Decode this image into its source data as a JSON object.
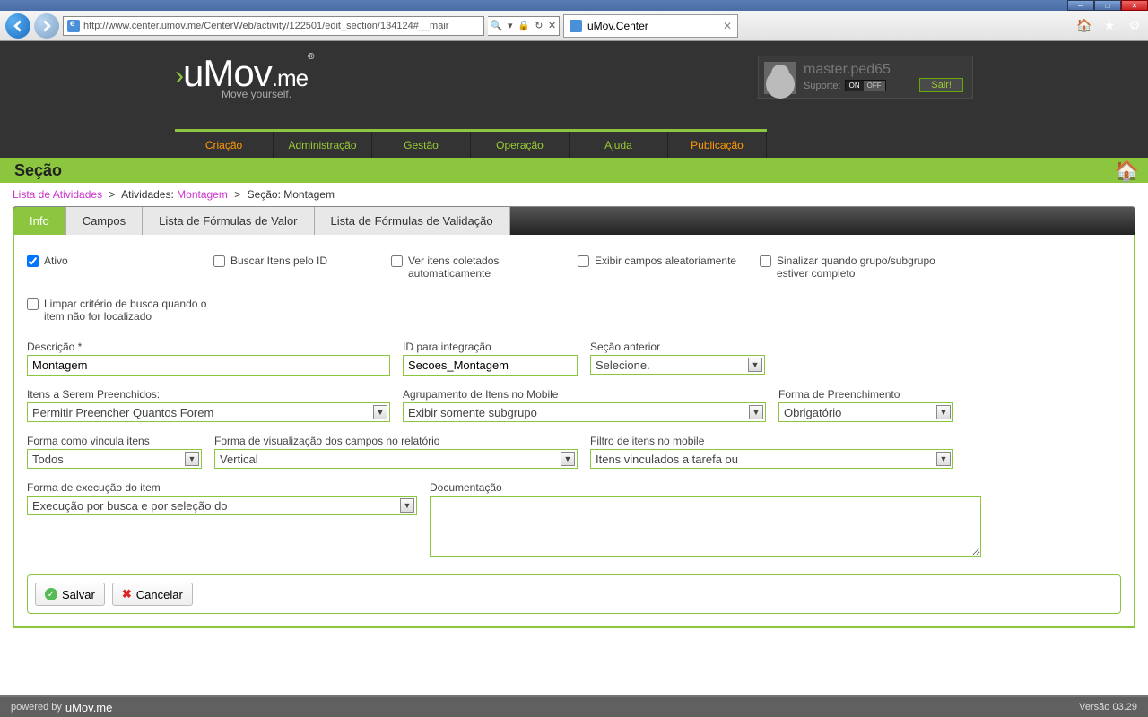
{
  "browser": {
    "url": "http://www.center.umov.me/CenterWeb/activity/122501/edit_section/134124#__mair",
    "tab_title": "uMov.Center"
  },
  "header": {
    "logo_text": "uMov.me",
    "tagline": "Move yourself.",
    "user": "master.ped65",
    "support_label": "Suporte:",
    "toggle_on": "ON",
    "toggle_off": "OFF",
    "logout": "Sair!"
  },
  "nav": {
    "items": [
      "Criação",
      "Administração",
      "Gestão",
      "Operação",
      "Ajuda",
      "Publicação"
    ]
  },
  "section_title": "Seção",
  "breadcrumb": {
    "p1": "Lista de Atividades",
    "p2": "Atividades:",
    "p3": "Montagem",
    "p4": "Seção: Montagem"
  },
  "tabs": {
    "info": "Info",
    "campos": "Campos",
    "lfv": "Lista de Fórmulas de Valor",
    "lfvd": "Lista de Fórmulas de Validação"
  },
  "checkboxes": {
    "ativo": "Ativo",
    "buscar": "Buscar Itens pelo ID",
    "ver": "Ver itens coletados automaticamente",
    "exibir": "Exibir campos aleatoriamente",
    "sinal": "Sinalizar quando grupo/subgrupo estiver completo",
    "limpar": "Limpar critério de busca quando o item não for localizado"
  },
  "fields": {
    "descricao": {
      "label": "Descrição *",
      "value": "Montagem"
    },
    "idint": {
      "label": "ID para integração",
      "value": "Secoes_Montagem"
    },
    "secant": {
      "label": "Seção anterior",
      "value": "Selecione."
    },
    "itens": {
      "label": "Itens a Serem Preenchidos:",
      "value": "Permitir Preencher Quantos Forem"
    },
    "agrup": {
      "label": "Agrupamento de Itens no Mobile",
      "value": "Exibir somente subgrupo"
    },
    "forma_preench": {
      "label": "Forma de Preenchimento",
      "value": "Obrigatório"
    },
    "forma_vinc": {
      "label": "Forma como vincula itens",
      "value": "Todos"
    },
    "forma_vis": {
      "label": "Forma de visualização dos campos no relatório",
      "value": "Vertical"
    },
    "filtro": {
      "label": "Filtro de itens no mobile",
      "value": "Itens vinculados a tarefa ou"
    },
    "forma_exec": {
      "label": "Forma de execução do item",
      "value": "Execução por busca e por seleção do"
    },
    "doc": {
      "label": "Documentação",
      "value": ""
    }
  },
  "buttons": {
    "save": "Salvar",
    "cancel": "Cancelar"
  },
  "footer": {
    "powered": "powered by",
    "brand": "uMov.me",
    "version": "Versão 03.29"
  }
}
